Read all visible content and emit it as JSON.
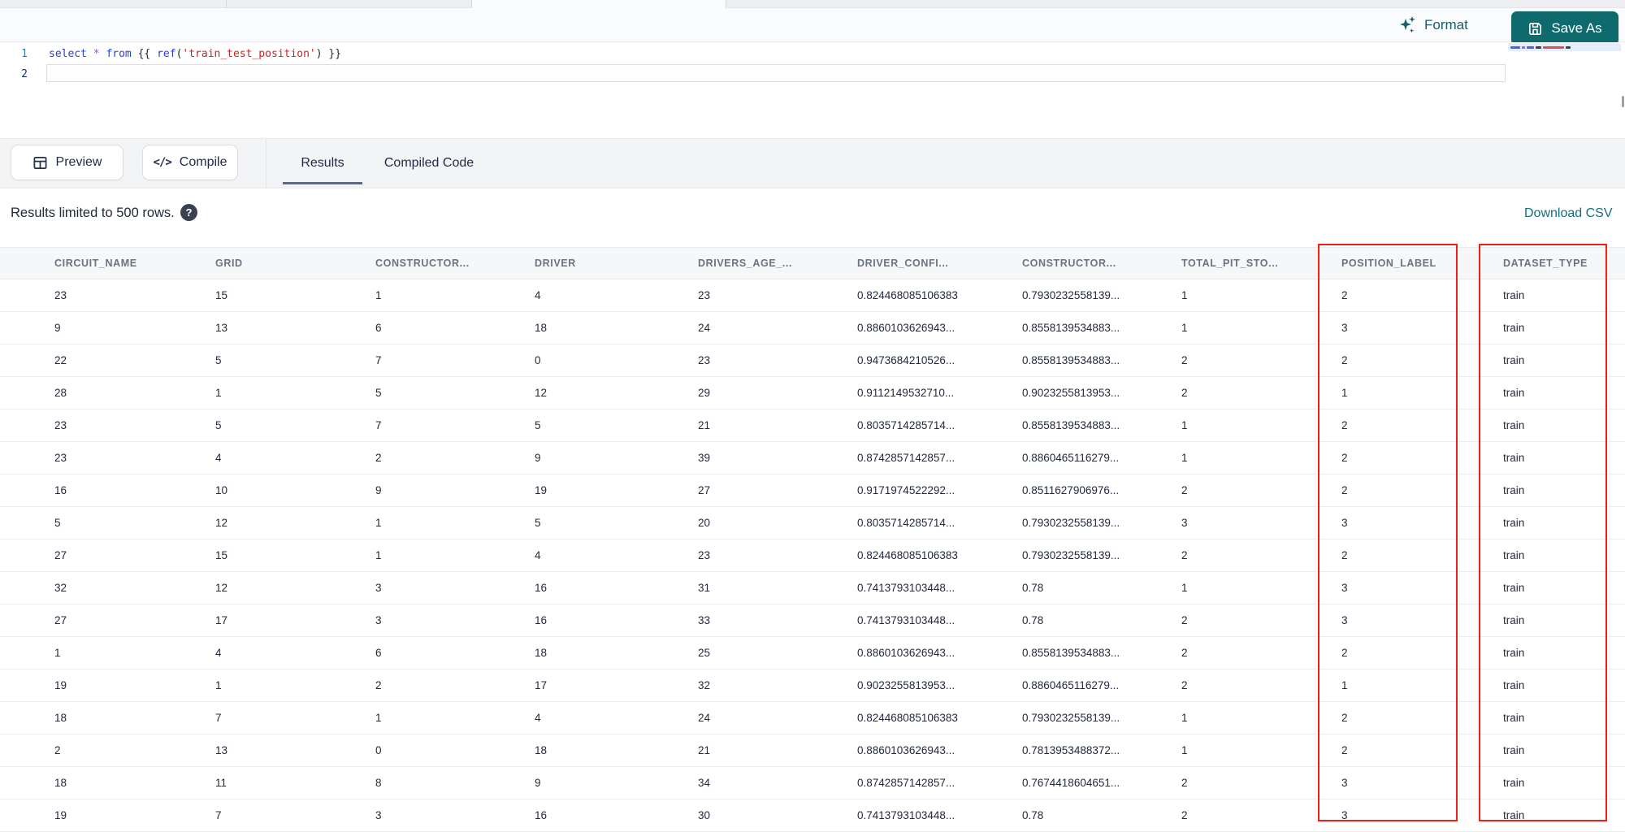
{
  "topbar": {
    "format_label": "Format",
    "save_as_label": "Save As"
  },
  "editor": {
    "line_numbers": [
      "1",
      "2"
    ],
    "code": {
      "kw_select": "select ",
      "op_star": "* ",
      "kw_from": "from ",
      "jinja_open": "{{ ",
      "fn_ref": "ref",
      "paren_open": "(",
      "string_arg": "'train_test_position'",
      "paren_close": ") ",
      "jinja_close": "}}"
    }
  },
  "action_bar": {
    "preview_label": "Preview",
    "compile_label": "Compile",
    "compile_icon_glyph": "</>",
    "tabs": [
      {
        "label": "Results",
        "active": true
      },
      {
        "label": "Compiled Code",
        "active": false
      }
    ]
  },
  "results": {
    "limit_note": "Results limited to 500 rows.",
    "help_icon_glyph": "?",
    "download_csv_label": "Download CSV"
  },
  "table": {
    "columns": [
      "CIRCUIT_NAME",
      "GRID",
      "CONSTRUCTOR...",
      "DRIVER",
      "DRIVERS_AGE_...",
      "DRIVER_CONFI...",
      "CONSTRUCTOR...",
      "TOTAL_PIT_STO...",
      "POSITION_LABEL",
      "DATASET_TYPE"
    ],
    "rows": [
      [
        "23",
        "15",
        "1",
        "4",
        "23",
        "0.824468085106383",
        "0.7930232558139...",
        "1",
        "2",
        "train"
      ],
      [
        "9",
        "13",
        "6",
        "18",
        "24",
        "0.8860103626943...",
        "0.8558139534883...",
        "1",
        "3",
        "train"
      ],
      [
        "22",
        "5",
        "7",
        "0",
        "23",
        "0.9473684210526...",
        "0.8558139534883...",
        "2",
        "2",
        "train"
      ],
      [
        "28",
        "1",
        "5",
        "12",
        "29",
        "0.9112149532710...",
        "0.9023255813953...",
        "2",
        "1",
        "train"
      ],
      [
        "23",
        "5",
        "7",
        "5",
        "21",
        "0.8035714285714...",
        "0.8558139534883...",
        "1",
        "2",
        "train"
      ],
      [
        "23",
        "4",
        "2",
        "9",
        "39",
        "0.8742857142857...",
        "0.8860465116279...",
        "1",
        "2",
        "train"
      ],
      [
        "16",
        "10",
        "9",
        "19",
        "27",
        "0.9171974522292...",
        "0.8511627906976...",
        "2",
        "2",
        "train"
      ],
      [
        "5",
        "12",
        "1",
        "5",
        "20",
        "0.8035714285714...",
        "0.7930232558139...",
        "3",
        "3",
        "train"
      ],
      [
        "27",
        "15",
        "1",
        "4",
        "23",
        "0.824468085106383",
        "0.7930232558139...",
        "2",
        "2",
        "train"
      ],
      [
        "32",
        "12",
        "3",
        "16",
        "31",
        "0.7413793103448...",
        "0.78",
        "1",
        "3",
        "train"
      ],
      [
        "27",
        "17",
        "3",
        "16",
        "33",
        "0.7413793103448...",
        "0.78",
        "2",
        "3",
        "train"
      ],
      [
        "1",
        "4",
        "6",
        "18",
        "25",
        "0.8860103626943...",
        "0.8558139534883...",
        "2",
        "2",
        "train"
      ],
      [
        "19",
        "1",
        "2",
        "17",
        "32",
        "0.9023255813953...",
        "0.8860465116279...",
        "2",
        "1",
        "train"
      ],
      [
        "18",
        "7",
        "1",
        "4",
        "24",
        "0.824468085106383",
        "0.7930232558139...",
        "1",
        "2",
        "train"
      ],
      [
        "2",
        "13",
        "0",
        "18",
        "21",
        "0.8860103626943...",
        "0.7813953488372...",
        "1",
        "2",
        "train"
      ],
      [
        "18",
        "11",
        "8",
        "9",
        "34",
        "0.8742857142857...",
        "0.7674418604651...",
        "2",
        "3",
        "train"
      ],
      [
        "19",
        "7",
        "3",
        "16",
        "30",
        "0.7413793103448...",
        "0.78",
        "2",
        "3",
        "train"
      ]
    ]
  },
  "annotations": {
    "highlight_color": "#ee2219",
    "highlighted_columns": [
      "POSITION_LABEL",
      "DATASET_TYPE"
    ]
  },
  "colors": {
    "accent_teal": "#0e6a6d",
    "link_teal": "#13707f",
    "string_red": "#c92222",
    "keyword_blue": "#2a3fd4"
  }
}
